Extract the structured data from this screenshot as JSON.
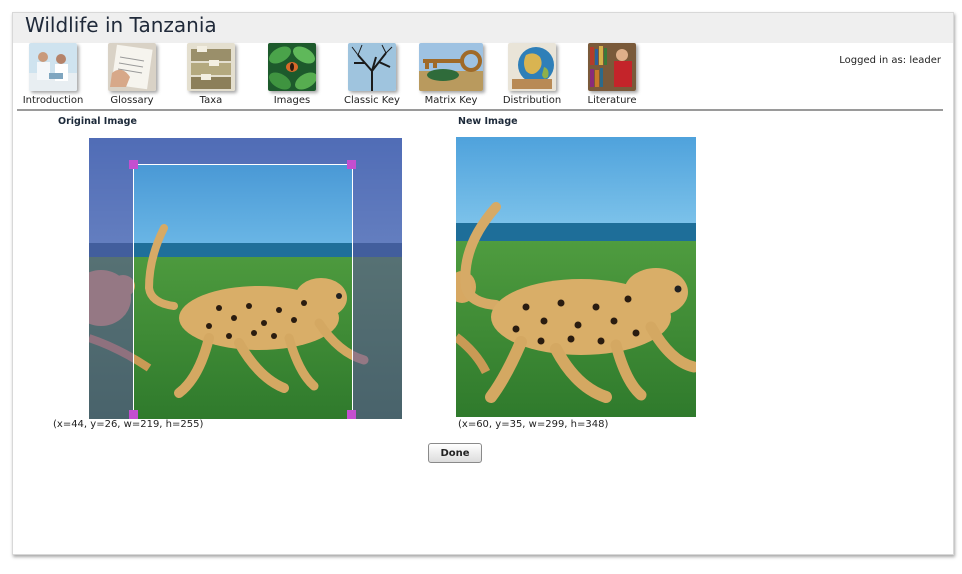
{
  "app": {
    "title": "Wildlife in Tanzania"
  },
  "nav": {
    "items": [
      {
        "label": "Introduction",
        "icon": "introduction-icon"
      },
      {
        "label": "Glossary",
        "icon": "glossary-icon"
      },
      {
        "label": "Taxa",
        "icon": "taxa-icon"
      },
      {
        "label": "Images",
        "icon": "images-icon"
      },
      {
        "label": "Classic Key",
        "icon": "classic-key-icon"
      },
      {
        "label": "Matrix Key",
        "icon": "matrix-key-icon"
      },
      {
        "label": "Distribution",
        "icon": "distribution-icon"
      },
      {
        "label": "Literature",
        "icon": "literature-icon"
      }
    ]
  },
  "user": {
    "status": "Logged in as: leader"
  },
  "original": {
    "title": "Original Image",
    "coords": "(x=44, y=26, w=219, h=255)"
  },
  "new_image": {
    "title": "New Image",
    "coords": "(x=60, y=35, w=299, h=348)"
  },
  "actions": {
    "done_label": "Done"
  },
  "colors": {
    "accent_handle": "#c44fd0",
    "sky": "#5aa8dc",
    "grass": "#3f8a36"
  }
}
